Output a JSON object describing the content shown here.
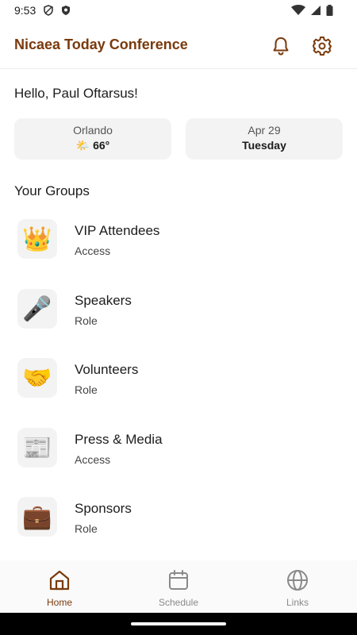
{
  "status": {
    "time": "9:53"
  },
  "app": {
    "title": "Nicaea Today Conference"
  },
  "greeting": "Hello, Paul Oftarsus!",
  "weather": {
    "city": "Orlando",
    "emoji": "🌤️",
    "temp": "66°"
  },
  "date_card": {
    "date": "Apr 29",
    "weekday": "Tuesday"
  },
  "groups": {
    "title": "Your Groups",
    "items": [
      {
        "name": "VIP Attendees",
        "sub": "Access",
        "emoji": "👑"
      },
      {
        "name": "Speakers",
        "sub": "Role",
        "emoji": "🎤"
      },
      {
        "name": "Volunteers",
        "sub": "Role",
        "emoji": "🤝"
      },
      {
        "name": "Press & Media",
        "sub": "Access",
        "emoji": "📰"
      },
      {
        "name": "Sponsors",
        "sub": "Role",
        "emoji": "💼"
      }
    ]
  },
  "nav": {
    "home": "Home",
    "schedule": "Schedule",
    "links": "Links"
  },
  "colors": {
    "accent": "#7a3a0c",
    "inactive": "#8a8a8a"
  }
}
